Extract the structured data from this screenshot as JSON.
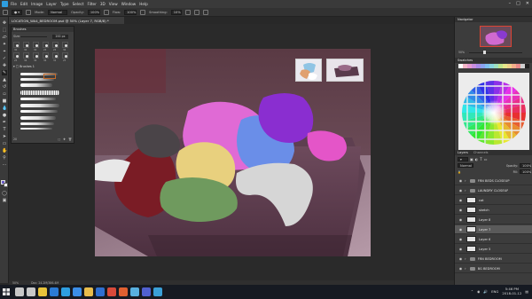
{
  "app": {
    "title": "Adobe Photoshop"
  },
  "menu": {
    "items": [
      "File",
      "Edit",
      "Image",
      "Layer",
      "Type",
      "Select",
      "Filter",
      "3D",
      "View",
      "Window",
      "Help"
    ]
  },
  "options_bar": {
    "mode_label": "Mode:",
    "mode_value": "Normal",
    "opacity_label": "Opacity:",
    "opacity_value": "100%",
    "flow_label": "Flow:",
    "flow_value": "100%",
    "smoothing_label": "Smoothing:",
    "smoothing_value": "10%"
  },
  "document_tab": {
    "label": "LOCATION_WA4_BEDROOM.psd @ 50% (Layer 7, RGB/8) *"
  },
  "brush_panel": {
    "title": "Brushes",
    "size_label": "Size:",
    "size_value": "200 px",
    "presets": [
      "30",
      "30",
      "30",
      "25",
      "25",
      "36",
      "25",
      "36",
      "36",
      "36",
      "32",
      "25"
    ],
    "folder_label": "Brushes 1",
    "footer_value": "20"
  },
  "status_bar": {
    "zoom": "50%",
    "doc_info": "Doc: 24.2M/386.4M"
  },
  "navigator": {
    "title": "Navigator",
    "zoom": "50%"
  },
  "swatches": {
    "title": "Swatches",
    "colors": [
      "#ffffff",
      "#f2b6c6",
      "#e59ad0",
      "#c98fe0",
      "#a78be8",
      "#8aa3f0",
      "#7ec0f0",
      "#89d6e0",
      "#9ee0c0",
      "#c0e68e",
      "#e6e68a",
      "#f0d08a",
      "#f2ae8a",
      "#e88a8a",
      "#d0d0d0",
      "#202020"
    ]
  },
  "layers": {
    "tabs": [
      "Layers",
      "Channels"
    ],
    "opacity_value": "100%",
    "fill_value": "100%",
    "rows": [
      {
        "name": "FRN BEDS CLOSEUP",
        "type": "folder",
        "selected": false
      },
      {
        "name": "LAUNDRY CLOSEUP",
        "type": "folder",
        "selected": false
      },
      {
        "name": "cat",
        "type": "layer",
        "selected": false
      },
      {
        "name": "sketch",
        "type": "layer",
        "selected": false
      },
      {
        "name": "Layer 8",
        "type": "layer",
        "selected": false
      },
      {
        "name": "Layer 7",
        "type": "layer",
        "selected": true
      },
      {
        "name": "Layer 6",
        "type": "layer",
        "selected": false
      },
      {
        "name": "Layer 5",
        "type": "layer",
        "selected": false
      },
      {
        "name": "FRN BEDROOM",
        "type": "folder",
        "selected": false
      },
      {
        "name": "BG BEDROOM",
        "type": "folder",
        "selected": false
      }
    ]
  },
  "taskbar": {
    "apps": [
      {
        "name": "search",
        "color": "#c8c8c8"
      },
      {
        "name": "task-view",
        "color": "#c8c8c8"
      },
      {
        "name": "chrome",
        "color": "#e8c33a"
      },
      {
        "name": "edge",
        "color": "#2b7bd5"
      },
      {
        "name": "photoshop",
        "color": "#2e9ee0"
      },
      {
        "name": "store",
        "color": "#3b8ee8"
      },
      {
        "name": "explorer",
        "color": "#e9bd4c"
      },
      {
        "name": "mail",
        "color": "#2f6fd0"
      },
      {
        "name": "media",
        "color": "#d84a3a"
      },
      {
        "name": "app-6",
        "color": "#e06030"
      },
      {
        "name": "app-7",
        "color": "#58b0e0"
      },
      {
        "name": "app-8",
        "color": "#5060d0"
      },
      {
        "name": "app-9",
        "color": "#3aa0d8"
      }
    ],
    "language": "ENG",
    "time": "5:46 PM",
    "date": "2018-01-12"
  }
}
